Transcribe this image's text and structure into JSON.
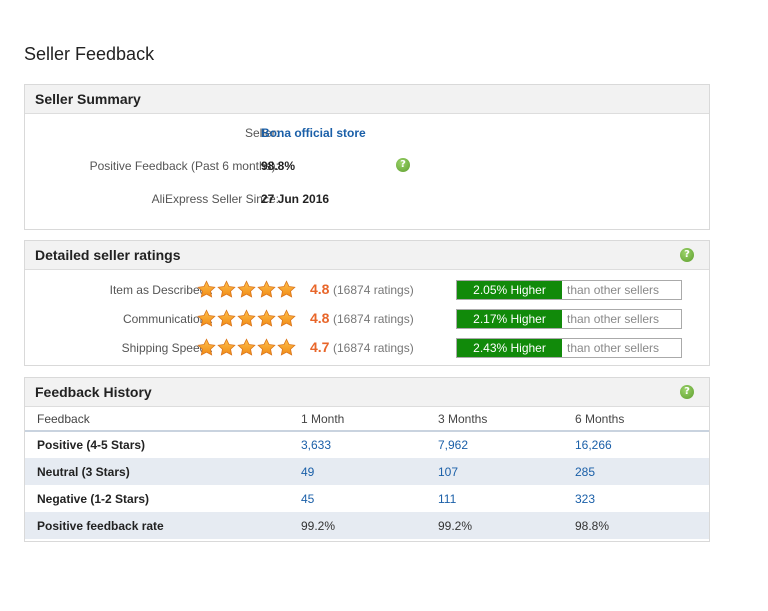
{
  "page": {
    "title": "Seller Feedback"
  },
  "summary": {
    "header": "Seller Summary",
    "seller_label": "Seller:",
    "seller_name": "Bona official store",
    "positive_label": "Positive Feedback (Past 6 months):",
    "positive_value": "98.8%",
    "since_label": "AliExpress Seller Since:",
    "since_value": "27 Jun 2016",
    "help_glyph": "?"
  },
  "ratings": {
    "header": "Detailed seller ratings",
    "help_glyph": "?",
    "items": [
      {
        "label": "Item as Described :",
        "score": "4.8",
        "stars": 5,
        "count": "(16874 ratings)",
        "higher": "2.05% Higher",
        "compare": "than other sellers"
      },
      {
        "label": "Communication :",
        "score": "4.8",
        "stars": 5,
        "count": "(16874 ratings)",
        "higher": "2.17% Higher",
        "compare": "than other sellers"
      },
      {
        "label": "Shipping Speed :",
        "score": "4.7",
        "stars": 5,
        "count": "(16874 ratings)",
        "higher": "2.43% Higher",
        "compare": "than other sellers"
      }
    ]
  },
  "history": {
    "header": "Feedback History",
    "help_glyph": "?",
    "columns": [
      "Feedback",
      "1 Month",
      "3 Months",
      "6 Months"
    ],
    "rows": [
      {
        "label": "Positive (4-5 Stars)",
        "values": [
          "3,633",
          "7,962",
          "16,266"
        ]
      },
      {
        "label": "Neutral (3 Stars)",
        "values": [
          "49",
          "107",
          "285"
        ]
      },
      {
        "label": "Negative (1-2 Stars)",
        "values": [
          "45",
          "111",
          "323"
        ]
      },
      {
        "label": "Positive feedback rate",
        "values": [
          "99.2%",
          "99.2%",
          "98.8%"
        ]
      }
    ]
  },
  "colors": {
    "accent_orange": "#e8662a",
    "link_blue": "#1a5fa8",
    "higher_green": "#118a0a",
    "help_green": "#6aad34"
  }
}
